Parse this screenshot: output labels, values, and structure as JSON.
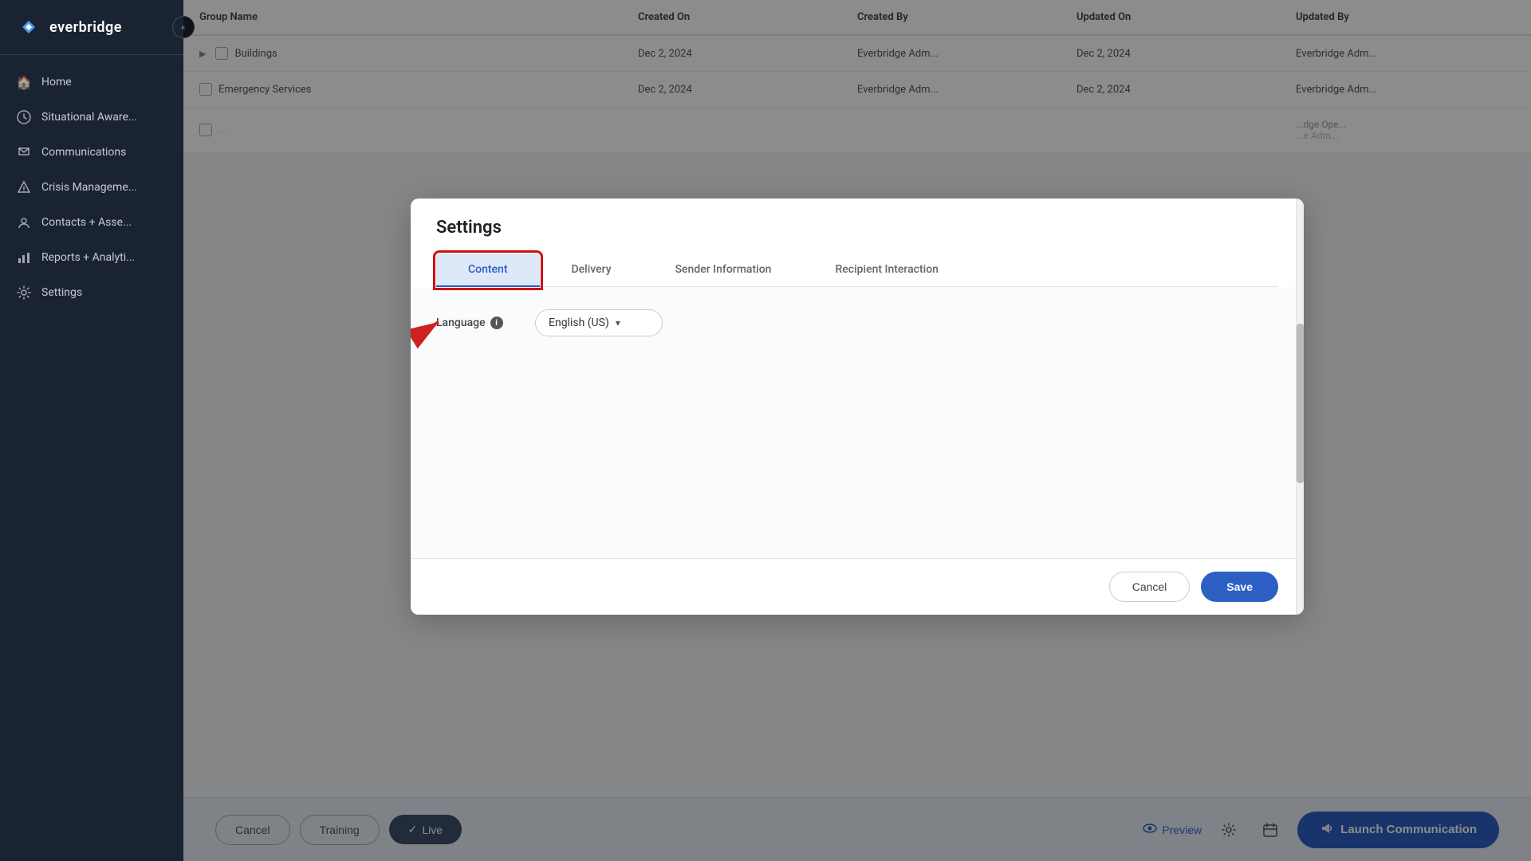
{
  "app": {
    "logo_text": "everbridge"
  },
  "sidebar": {
    "collapse_icon": "«",
    "items": [
      {
        "id": "home",
        "label": "Home",
        "icon": "⌂"
      },
      {
        "id": "situational-awareness",
        "label": "Situational Aware...",
        "icon": "👁"
      },
      {
        "id": "communications",
        "label": "Communications",
        "icon": "📢"
      },
      {
        "id": "crisis-management",
        "label": "Crisis Manageme...",
        "icon": "🔔"
      },
      {
        "id": "contacts-assets",
        "label": "Contacts + Asse...",
        "icon": "📍"
      },
      {
        "id": "reports-analytics",
        "label": "Reports + Analyti...",
        "icon": "📊"
      },
      {
        "id": "settings",
        "label": "Settings",
        "icon": "⚙"
      }
    ]
  },
  "background_table": {
    "columns": [
      "Group Name",
      "Created On",
      "Created By",
      "Updated On",
      "Updated By"
    ],
    "rows": [
      {
        "name": "Buildings",
        "created_on": "Dec 2, 2024",
        "created_by": "Everbridge Adm...",
        "updated_on": "Dec 2, 2024",
        "updated_by": "Everbridge Adm..."
      },
      {
        "name": "Emergency Services",
        "created_on": "Dec 2, 2024",
        "created_by": "Everbridge Adm...",
        "updated_on": "Dec 2, 2024",
        "updated_by": "Everbridge Adm..."
      },
      {
        "name": "...",
        "created_on": "...",
        "created_by": "...",
        "updated_on": "...",
        "updated_by": "...dge Ope..."
      }
    ]
  },
  "bottom_toolbar": {
    "cancel_label": "Cancel",
    "training_label": "Training",
    "live_label": "Live",
    "live_check": "✓",
    "preview_label": "Preview",
    "launch_label": "Launch Communication",
    "launch_icon": "📢"
  },
  "modal": {
    "title": "Settings",
    "tabs": [
      {
        "id": "content",
        "label": "Content",
        "active": true
      },
      {
        "id": "delivery",
        "label": "Delivery",
        "active": false
      },
      {
        "id": "sender-information",
        "label": "Sender Information",
        "active": false
      },
      {
        "id": "recipient-interaction",
        "label": "Recipient Interaction",
        "active": false
      }
    ],
    "language_label": "Language",
    "language_info_tooltip": "i",
    "language_value": "English (US)",
    "language_arrow": "▾",
    "cancel_label": "Cancel",
    "save_label": "Save"
  },
  "colors": {
    "brand_blue": "#2d5fc4",
    "sidebar_bg": "#1a2332",
    "active_tab_bg": "#dde8f8",
    "red_highlight": "#cc1111"
  }
}
